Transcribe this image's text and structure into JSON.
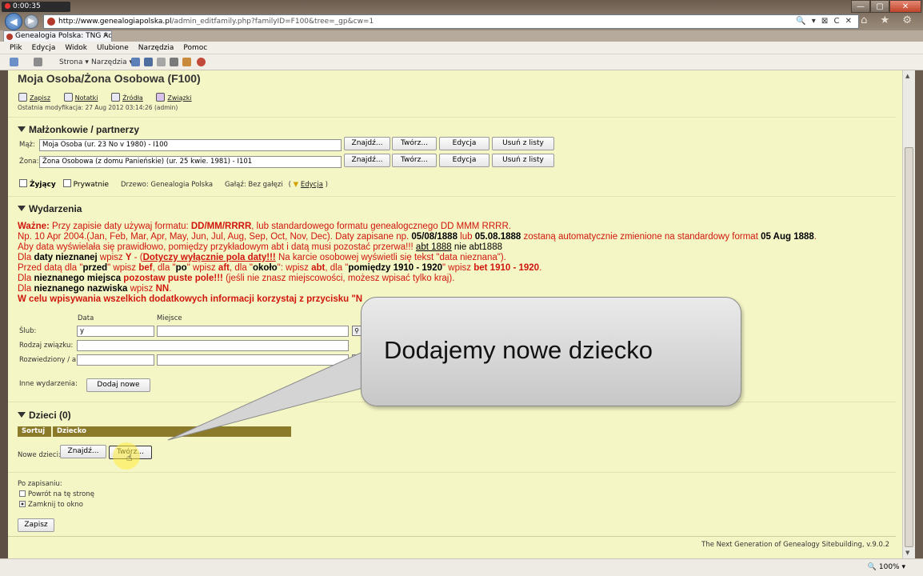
{
  "recorder": {
    "time": "0:00:35"
  },
  "browser": {
    "url_host": "http://www.genealogiapolska.pl",
    "url_path": "/admin_editfamily.php?familyID=F100&tree=_gp&cw=1",
    "addr_tools": "🔍 ▾ ⊠ C ✕",
    "tab_title": "Genealogia Polska: TNG Ad...",
    "tab_close": "✕",
    "win_controls": {
      "min": "—",
      "max": "▢",
      "close": "✕"
    },
    "chrome_icons": "⌂ ★ ⚙",
    "menu": [
      "Plik",
      "Edycja",
      "Widok",
      "Ulubione",
      "Narzędzia",
      "Pomoc"
    ],
    "cmd": {
      "page": "Strona ▾",
      "tools": "Narzędzia ▾"
    },
    "zoom": "🔍 100% ▾"
  },
  "page": {
    "title": "Moja Osoba/Żona Osobowa (F100)",
    "actions": [
      "Zapisz",
      "Notatki",
      "Źródła",
      "Związki"
    ],
    "last_modified": "Ostatnia modyfikacja: 27 Aug 2012 03:14:26 (admin)"
  },
  "spouses": {
    "heading": "Małżonkowie / partnerzy",
    "husband_label": "Mąż:",
    "husband_value": "Moja Osoba (ur. 23 No v 1980) - I100",
    "wife_label": "Żona:",
    "wife_value": "Żona Osobowa (z domu Panieńskie) (ur. 25 kwie. 1981) - I101",
    "buttons": {
      "find": "Znajdź...",
      "create": "Twórz...",
      "edit": "Edycja",
      "remove": "Usuń z listy"
    },
    "living_label": "Żyjący",
    "private_label": "Prywatnie",
    "tree_text": "Drzewo: Genealogia Polska",
    "branch_text": "Gałąź: Bez gałęzi",
    "branch_edit": "Edycja"
  },
  "events": {
    "heading": "Wydarzenia",
    "info": {
      "l1a": "Ważne:",
      "l1b": " Przy zapisie daty używaj formatu: ",
      "l1c": "DD/MM/RRRR",
      "l1d": ", lub standardowego formatu genealogcznego DD MMM RRRR.",
      "l2a": "Np. 10 Apr 2004.(Jan, Feb, Mar, Apr, May, Jun, Jul, Aug, Sep, Oct, Nov, Dec). Daty zapisane np. ",
      "l2b": "05/08/1888",
      "l2c": " lub ",
      "l2d": "05.08.1888",
      "l2e": " zostaną automatycznie zmienione na standardowy format ",
      "l2f": "05 Aug 1888",
      "l2g": ".",
      "l3a": "Aby data wyświelała się prawidłowo, pomiędzy przykładowym abt i datą musi pozostać przerwa!!! ",
      "l3b": "abt 1888",
      "l3c": " nie abt1888",
      "l4a": "Dla ",
      "l4b": "daty nieznanej",
      "l4c": " wpisz ",
      "l4d": "Y",
      "l4e": " - (",
      "l4f": "Dotyczy wyłącznie pola daty!!!",
      "l4g": " Na karcie osobowej wyświetli się tekst \"data nieznana\").",
      "l5a": "Przed datą dla \"",
      "l5b": "przed",
      "l5c": "\" wpisz ",
      "l5d": "bef",
      "l5e": ", dla \"",
      "l5f": "po",
      "l5g": "\" wpisz ",
      "l5h": "aft",
      "l5i": ", dla \"",
      "l5j": "około",
      "l5k": "\": wpisz ",
      "l5l": "abt",
      "l5m": ", dla \"",
      "l5n": "pomiędzy 1910 - 1920",
      "l5o": "\" wpisz ",
      "l5p": "bet 1910 - 1920",
      "l5q": ".",
      "l6a": "Dla ",
      "l6b": "nieznanego miejsca",
      "l6c": " pozostaw puste pole!!!",
      "l6d": " (jeśli nie znasz miejscowości, możesz wpisać tylko kraj).",
      "l7a": "Dla ",
      "l7b": "nieznanego nazwiska",
      "l7c": " wpisz ",
      "l7d": "NN",
      "l7e": ".",
      "l8": "W celu wpisywania wszelkich dodatkowych informacji korzystaj z przycisku \"N"
    },
    "col_date": "Data",
    "col_place": "Miejsce",
    "marriage_label": "Ślub:",
    "marriage_date": "y",
    "relation_label": "Rodzaj związku:",
    "divorce_label": "Rozwiedziony / a:",
    "other_label": "Inne wydarzenia:",
    "add_new": "Dodaj nowe"
  },
  "children": {
    "heading": "Dzieci (0)",
    "col_sort": "Sortuj",
    "col_child": "Dziecko",
    "new_label": "Nowe dzieci:",
    "find": "Znajdź...",
    "create": "Twórz..."
  },
  "after_save": {
    "label": "Po zapisaniu:",
    "opt_return": "Powrót na tę stronę",
    "opt_close": "Zamknij to okno",
    "save_button": "Zapisz"
  },
  "footer": "The Next Generation of Genealogy Sitebuilding, v.9.0.2",
  "callout": "Dodajemy nowe dziecko"
}
